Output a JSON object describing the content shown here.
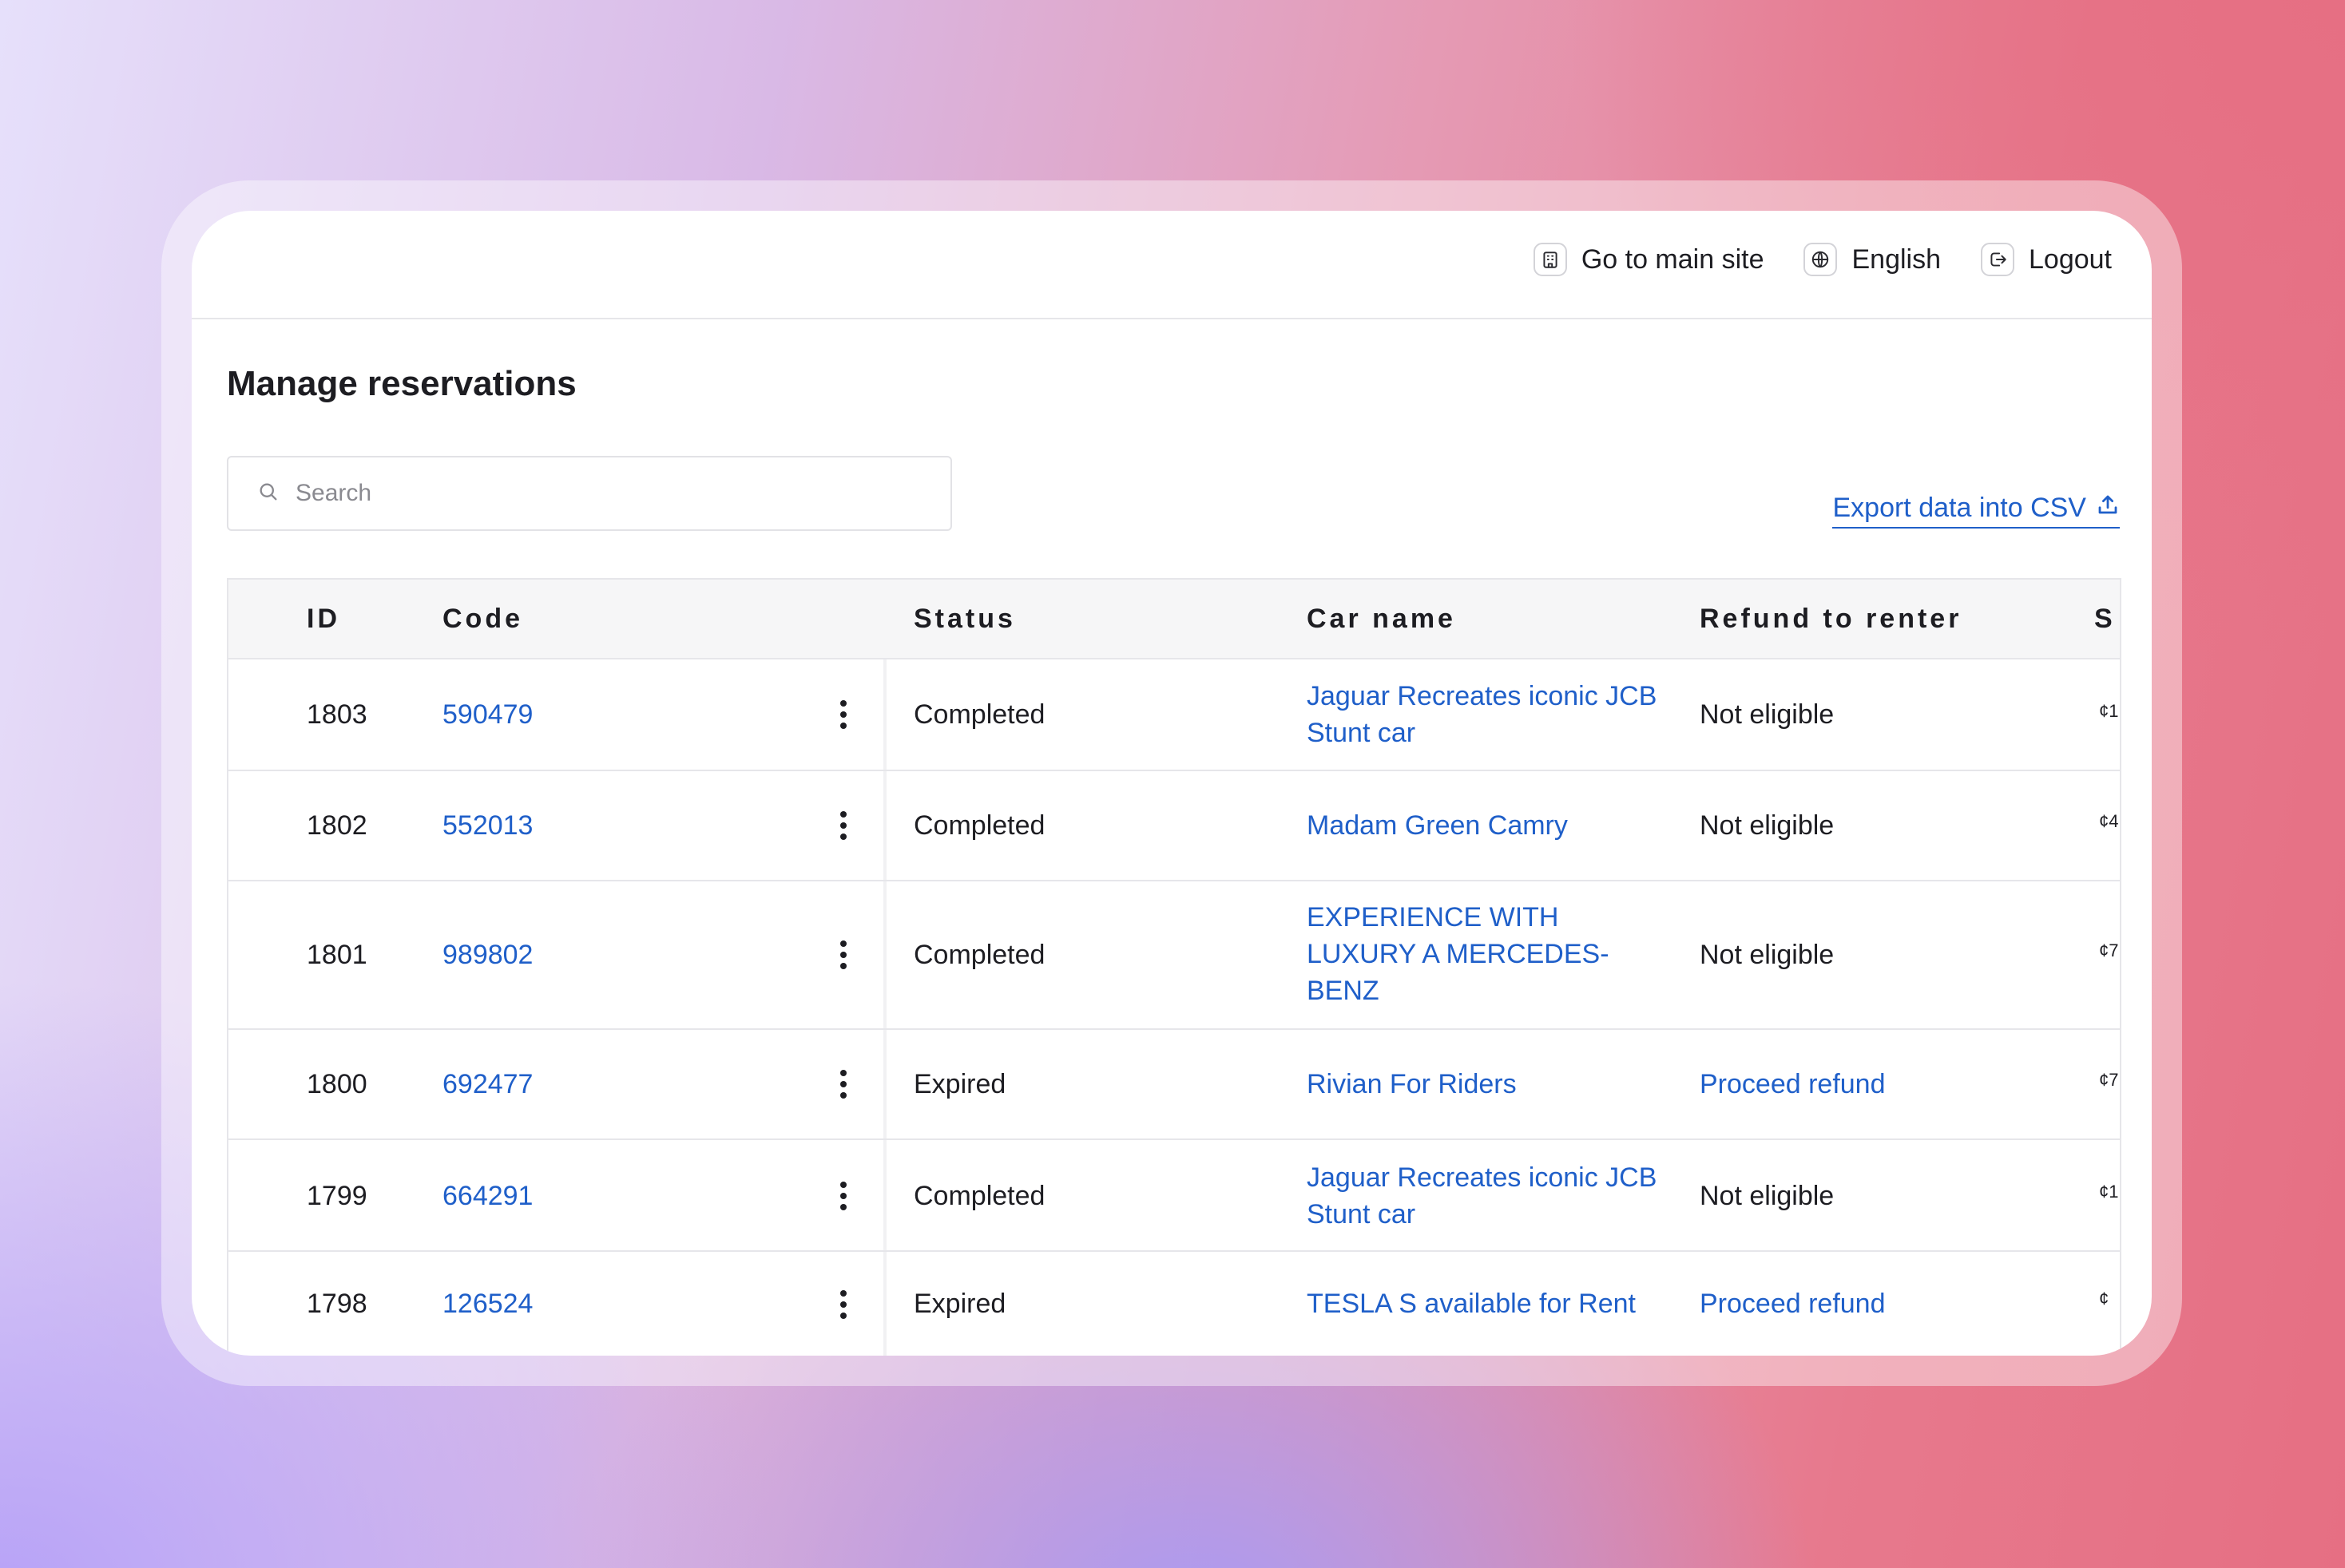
{
  "topbar": {
    "go_main": "Go to main site",
    "language": "English",
    "logout": "Logout"
  },
  "page": {
    "title": "Manage reservations"
  },
  "search": {
    "placeholder": "Search"
  },
  "export": {
    "label": "Export data into CSV"
  },
  "table": {
    "headers": {
      "id": "ID",
      "code": "Code",
      "status": "Status",
      "car_name": "Car name",
      "refund": "Refund to renter",
      "clipped": "S"
    },
    "rows": [
      {
        "id": "1803",
        "code": "590479",
        "status": "Completed",
        "car": "Jaguar Recreates iconic JCB Stunt car",
        "refund": "Not eligible",
        "price": "¢1"
      },
      {
        "id": "1802",
        "code": "552013",
        "status": "Completed",
        "car": "Madam Green Camry",
        "refund": "Not eligible",
        "price": "¢4"
      },
      {
        "id": "1801",
        "code": "989802",
        "status": "Completed",
        "car": "EXPERIENCE WITH LUXURY A MERCEDES-BENZ",
        "refund": "Not eligible",
        "price": "¢7"
      },
      {
        "id": "1800",
        "code": "692477",
        "status": "Expired",
        "car": "Rivian For Riders",
        "refund": "Proceed refund",
        "price": "¢7"
      },
      {
        "id": "1799",
        "code": "664291",
        "status": "Completed",
        "car": "Jaguar Recreates iconic JCB Stunt car",
        "refund": "Not eligible",
        "price": "¢1"
      },
      {
        "id": "1798",
        "code": "126524",
        "status": "Expired",
        "car": "TESLA S available for Rent",
        "refund": "Proceed refund",
        "price": "¢"
      }
    ]
  },
  "colors": {
    "link": "#1f5fc9",
    "text": "#1d1d22",
    "border": "#e6e6ea"
  },
  "icons": {
    "go_main": "building-icon",
    "language": "globe-icon",
    "logout": "logout-icon",
    "search": "search-icon",
    "export": "upload-icon",
    "row_menu": "kebab-menu-icon"
  }
}
